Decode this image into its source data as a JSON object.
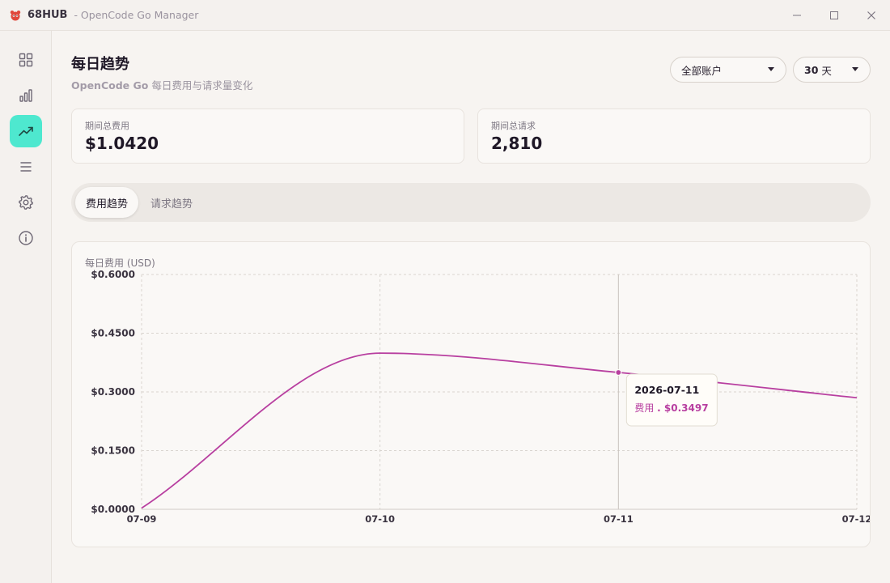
{
  "window": {
    "app_name": "68HUB",
    "app_subtitle": "- OpenCode Go Manager",
    "controls": {
      "minimize": "—",
      "maximize": "☐",
      "close": "✕"
    }
  },
  "sidebar": {
    "items": [
      {
        "name": "dashboard",
        "icon": "grid-icon",
        "active": false
      },
      {
        "name": "usage",
        "icon": "bar-chart-icon",
        "active": false
      },
      {
        "name": "trends",
        "icon": "trend-up-icon",
        "active": true
      },
      {
        "name": "list",
        "icon": "list-icon",
        "active": false
      },
      {
        "name": "settings",
        "icon": "gear-icon",
        "active": false
      },
      {
        "name": "about",
        "icon": "info-icon",
        "active": false
      }
    ],
    "accent_color": "#4ee8cf"
  },
  "header": {
    "title": "每日趋势",
    "subtitle_brand": "OpenCode Go",
    "subtitle_text": " 每日费用与请求量变化"
  },
  "filters": {
    "account": {
      "selected": "全部账户"
    },
    "range_value": "30",
    "range_unit": "天"
  },
  "stats": {
    "cost": {
      "label": "期间总费用",
      "value": "$1.0420"
    },
    "requests": {
      "label": "期间总请求",
      "value": "2,810"
    }
  },
  "tabs": [
    {
      "label": "费用趋势",
      "active": true
    },
    {
      "label": "请求趋势",
      "active": false
    }
  ],
  "chart_data": {
    "type": "line",
    "title": "每日费用 (USD)",
    "x": [
      "07-09",
      "07-10",
      "07-11",
      "07-12"
    ],
    "series": [
      {
        "values": [
          0.003,
          0.399,
          0.3497,
          0.285
        ],
        "color": "#b83fa0"
      }
    ],
    "y_ticks": [
      "$0.6000",
      "$0.4500",
      "$0.3000",
      "$0.1500",
      "$0.0000"
    ],
    "ylim": [
      0,
      0.6
    ],
    "grid": true,
    "tooltip": {
      "date": "2026-07-11",
      "series_label": "费用",
      "value": "$0.3497",
      "index": 2
    }
  }
}
